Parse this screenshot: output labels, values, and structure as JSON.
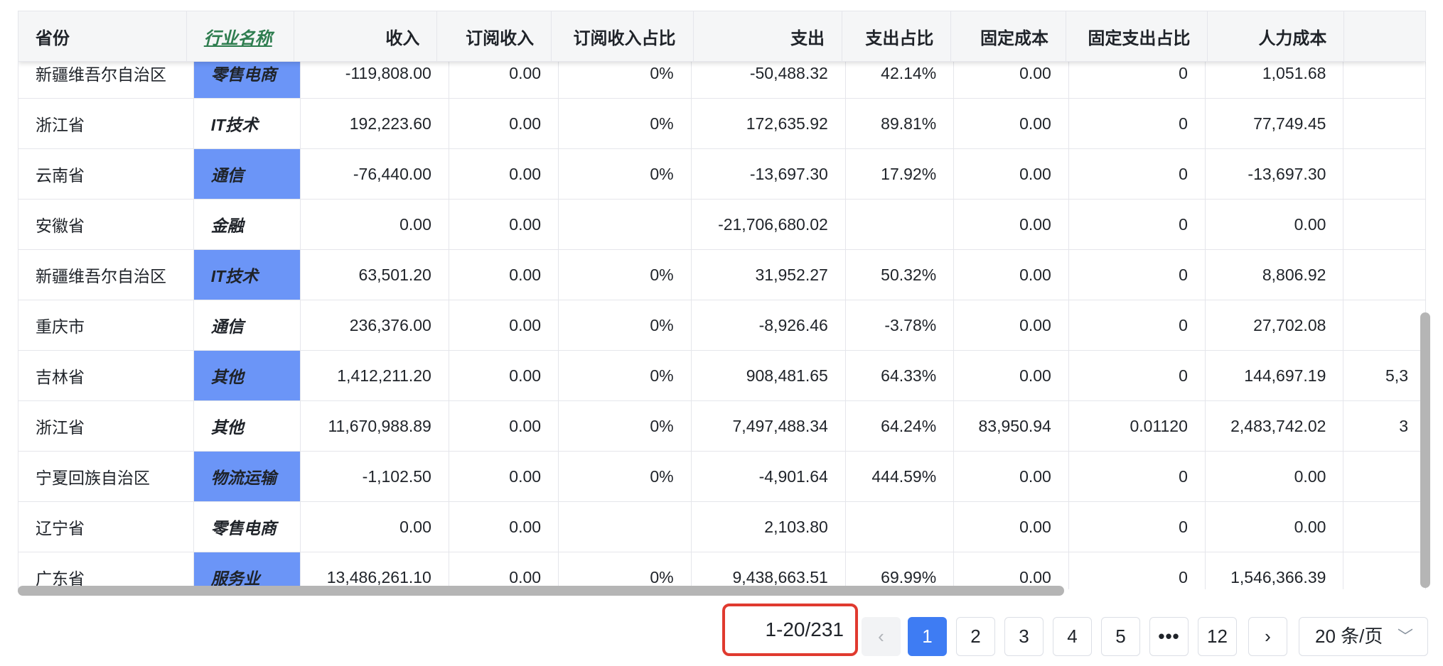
{
  "table": {
    "columns": [
      {
        "label": "省份",
        "align": "left"
      },
      {
        "label": "行业名称",
        "align": "left"
      },
      {
        "label": "收入",
        "align": "right"
      },
      {
        "label": "订阅收入",
        "align": "right"
      },
      {
        "label": "订阅收入占比",
        "align": "right"
      },
      {
        "label": "支出",
        "align": "right"
      },
      {
        "label": "支出占比",
        "align": "right"
      },
      {
        "label": "固定成本",
        "align": "right"
      },
      {
        "label": "固定支出占比",
        "align": "right"
      },
      {
        "label": "人力成本",
        "align": "right"
      },
      {
        "label": "",
        "align": "right"
      }
    ],
    "rows": [
      {
        "province": "新疆维吾尔自治区",
        "industry": "零售电商",
        "highlight": true,
        "income": "-119,808.00",
        "sub_income": "0.00",
        "sub_ratio": "0%",
        "expense": "-50,488.32",
        "expense_ratio": "42.14%",
        "fixed_cost": "0.00",
        "fixed_ratio": "0",
        "labor_cost": "1,051.68",
        "extra": ""
      },
      {
        "province": "浙江省",
        "industry": "IT技术",
        "highlight": false,
        "income": "192,223.60",
        "sub_income": "0.00",
        "sub_ratio": "0%",
        "expense": "172,635.92",
        "expense_ratio": "89.81%",
        "fixed_cost": "0.00",
        "fixed_ratio": "0",
        "labor_cost": "77,749.45",
        "extra": ""
      },
      {
        "province": "云南省",
        "industry": "通信",
        "highlight": true,
        "income": "-76,440.00",
        "sub_income": "0.00",
        "sub_ratio": "0%",
        "expense": "-13,697.30",
        "expense_ratio": "17.92%",
        "fixed_cost": "0.00",
        "fixed_ratio": "0",
        "labor_cost": "-13,697.30",
        "extra": ""
      },
      {
        "province": "安徽省",
        "industry": "金融",
        "highlight": false,
        "income": "0.00",
        "sub_income": "0.00",
        "sub_ratio": "",
        "expense": "-21,706,680.02",
        "expense_ratio": "",
        "fixed_cost": "0.00",
        "fixed_ratio": "0",
        "labor_cost": "0.00",
        "extra": ""
      },
      {
        "province": "新疆维吾尔自治区",
        "industry": "IT技术",
        "highlight": true,
        "income": "63,501.20",
        "sub_income": "0.00",
        "sub_ratio": "0%",
        "expense": "31,952.27",
        "expense_ratio": "50.32%",
        "fixed_cost": "0.00",
        "fixed_ratio": "0",
        "labor_cost": "8,806.92",
        "extra": ""
      },
      {
        "province": "重庆市",
        "industry": "通信",
        "highlight": false,
        "income": "236,376.00",
        "sub_income": "0.00",
        "sub_ratio": "0%",
        "expense": "-8,926.46",
        "expense_ratio": "-3.78%",
        "fixed_cost": "0.00",
        "fixed_ratio": "0",
        "labor_cost": "27,702.08",
        "extra": ""
      },
      {
        "province": "吉林省",
        "industry": "其他",
        "highlight": true,
        "income": "1,412,211.20",
        "sub_income": "0.00",
        "sub_ratio": "0%",
        "expense": "908,481.65",
        "expense_ratio": "64.33%",
        "fixed_cost": "0.00",
        "fixed_ratio": "0",
        "labor_cost": "144,697.19",
        "extra": "5,3"
      },
      {
        "province": "浙江省",
        "industry": "其他",
        "highlight": false,
        "income": "11,670,988.89",
        "sub_income": "0.00",
        "sub_ratio": "0%",
        "expense": "7,497,488.34",
        "expense_ratio": "64.24%",
        "fixed_cost": "83,950.94",
        "fixed_ratio": "0.01120",
        "labor_cost": "2,483,742.02",
        "extra": "3"
      },
      {
        "province": "宁夏回族自治区",
        "industry": "物流运输",
        "highlight": true,
        "income": "-1,102.50",
        "sub_income": "0.00",
        "sub_ratio": "0%",
        "expense": "-4,901.64",
        "expense_ratio": "444.59%",
        "fixed_cost": "0.00",
        "fixed_ratio": "0",
        "labor_cost": "0.00",
        "extra": ""
      },
      {
        "province": "辽宁省",
        "industry": "零售电商",
        "highlight": false,
        "income": "0.00",
        "sub_income": "0.00",
        "sub_ratio": "",
        "expense": "2,103.80",
        "expense_ratio": "",
        "fixed_cost": "0.00",
        "fixed_ratio": "0",
        "labor_cost": "0.00",
        "extra": ""
      },
      {
        "province": "广东省",
        "industry": "服务业",
        "highlight": true,
        "income": "13,486,261.10",
        "sub_income": "0.00",
        "sub_ratio": "0%",
        "expense": "9,438,663.51",
        "expense_ratio": "69.99%",
        "fixed_cost": "0.00",
        "fixed_ratio": "0",
        "labor_cost": "1,546,366.39",
        "extra": ""
      }
    ]
  },
  "pagination": {
    "total_text": "1-20/231",
    "prev_icon": "chevron-left-icon",
    "next_icon": "chevron-right-icon",
    "pages": [
      "1",
      "2",
      "3",
      "4",
      "5",
      "•••",
      "12"
    ],
    "current_page": "1",
    "page_size_label": "20 条/页",
    "page_size_icon": "chevron-down-icon"
  },
  "colors": {
    "highlight_cell": "#6b95f7",
    "active_page": "#3e7cf3",
    "total_box_border": "#e03a2f",
    "industry_header": "#2e7d4f"
  }
}
